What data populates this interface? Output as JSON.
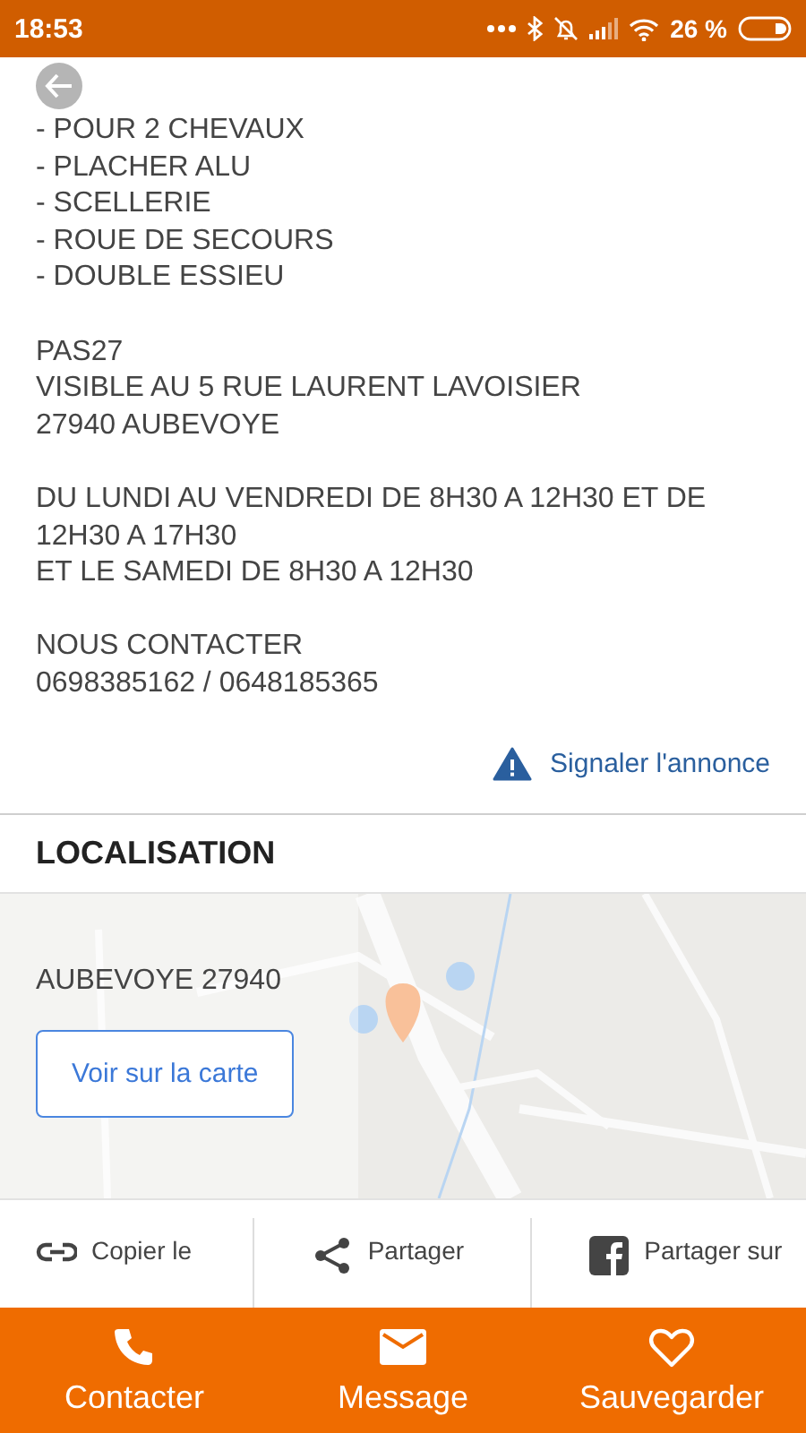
{
  "status_bar": {
    "time": "18:53",
    "battery": "26 %"
  },
  "description": {
    "paragraphs": [
      [
        "- POUR 2 CHEVAUX",
        "- PLACHER ALU",
        "- SCELLERIE",
        "- ROUE DE SECOURS",
        "- DOUBLE ESSIEU"
      ],
      [
        "PAS27",
        "VISIBLE AU 5 RUE LAURENT LAVOISIER",
        "27940 AUBEVOYE"
      ],
      [
        "DU LUNDI AU VENDREDI DE 8H30 A 12H30 ET DE 12H30 A 17H30",
        "ET LE SAMEDI DE 8H30 A 12H30"
      ],
      [
        "NOUS CONTACTER",
        "0698385162 / 0648185365"
      ]
    ]
  },
  "report_link": "Signaler l'annonce",
  "location": {
    "title": "LOCALISATION",
    "address": "AUBEVOYE 27940",
    "map_button": "Voir sur la carte"
  },
  "share_actions": [
    {
      "kind": "link",
      "label": "Copier le"
    },
    {
      "kind": "share",
      "label": "Partager"
    },
    {
      "kind": "facebook",
      "label": "Partager sur"
    }
  ],
  "bottom_nav": [
    {
      "kind": "phone",
      "label": "Contacter"
    },
    {
      "kind": "mail",
      "label": "Message"
    },
    {
      "kind": "heart",
      "label": "Sauvegarder"
    }
  ]
}
